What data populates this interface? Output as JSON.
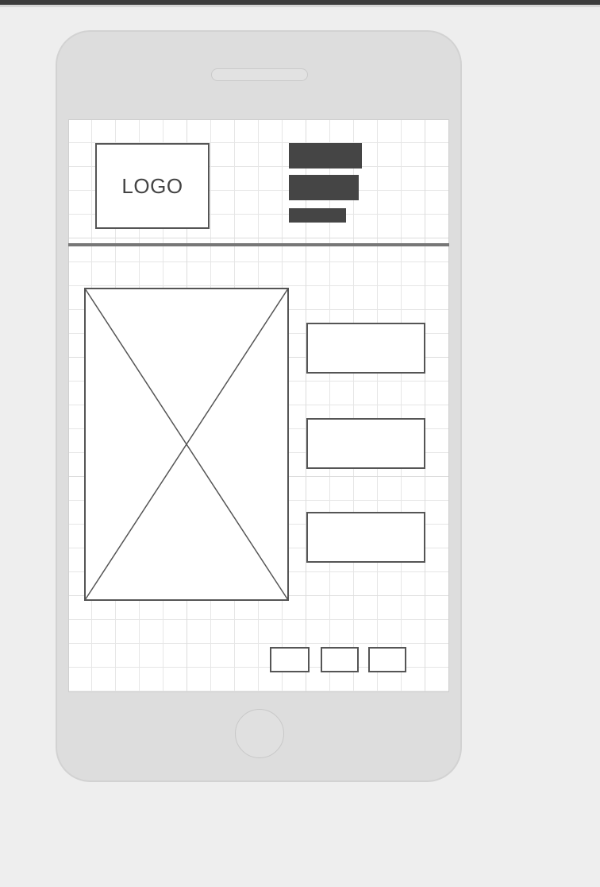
{
  "header": {
    "logo_text": "LOGO"
  },
  "colors": {
    "background": "#eeeeee",
    "device_body": "#dddddd",
    "outline": "#555555",
    "nav_block": "#454545",
    "divider": "#777777",
    "grid": "#e6e6e6"
  },
  "icons": {
    "image_placeholder": "image-placeholder-icon",
    "home_button": "home-button-icon",
    "speaker": "speaker-icon"
  }
}
